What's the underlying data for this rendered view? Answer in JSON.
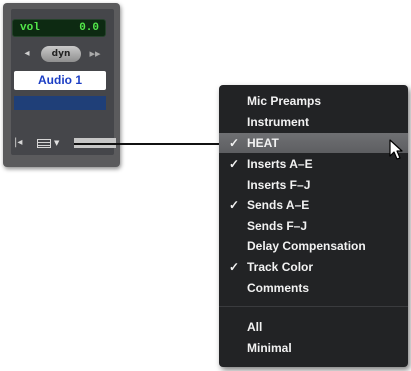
{
  "strip": {
    "vol_label": "vol",
    "vol_value": "0.0",
    "dyn_label": "dyn",
    "track_name": "Audio 1",
    "track_color": "#1f3f78",
    "icons": {
      "left_arrow": "arrow-left-icon",
      "ff": "fast-forward-icon",
      "width": "strip-width-icon",
      "view": "view-selector-icon",
      "dropdown": "dropdown-triangle-icon"
    }
  },
  "menu": {
    "items": [
      {
        "label": "Mic Preamps",
        "checked": false
      },
      {
        "label": "Instrument",
        "checked": false
      },
      {
        "label": "HEAT",
        "checked": true,
        "highlighted": true
      },
      {
        "label": "Inserts A–E",
        "checked": true
      },
      {
        "label": "Inserts F–J",
        "checked": false
      },
      {
        "label": "Sends A–E",
        "checked": true
      },
      {
        "label": "Sends F–J",
        "checked": false
      },
      {
        "label": "Delay Compensation",
        "checked": false
      },
      {
        "label": "Track Color",
        "checked": true
      },
      {
        "label": "Comments",
        "checked": false
      }
    ],
    "footer_items": [
      {
        "label": "All"
      },
      {
        "label": "Minimal"
      }
    ],
    "check_glyph": "✓",
    "highlight_color": "#66676a"
  }
}
